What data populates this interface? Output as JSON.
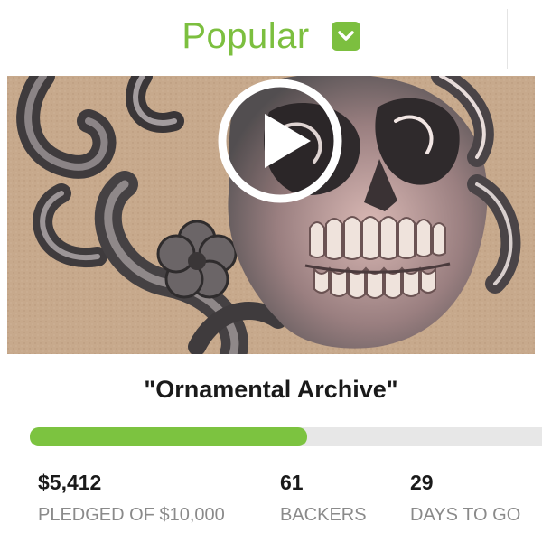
{
  "header": {
    "title": "Popular",
    "dropdown_icon": "chevron-down-icon",
    "accent_color": "#7cbf3f"
  },
  "project": {
    "title": "\"Ornamental Archive\"",
    "media_icon": "play-icon"
  },
  "funding": {
    "progress_fraction": 0.541,
    "fill_color": "#7cc340"
  },
  "stats": [
    {
      "value": "$5,412",
      "label": "PLEDGED OF $10,000"
    },
    {
      "value": "61",
      "label": "BACKERS"
    },
    {
      "value": "29",
      "label": "DAYS TO GO"
    }
  ]
}
